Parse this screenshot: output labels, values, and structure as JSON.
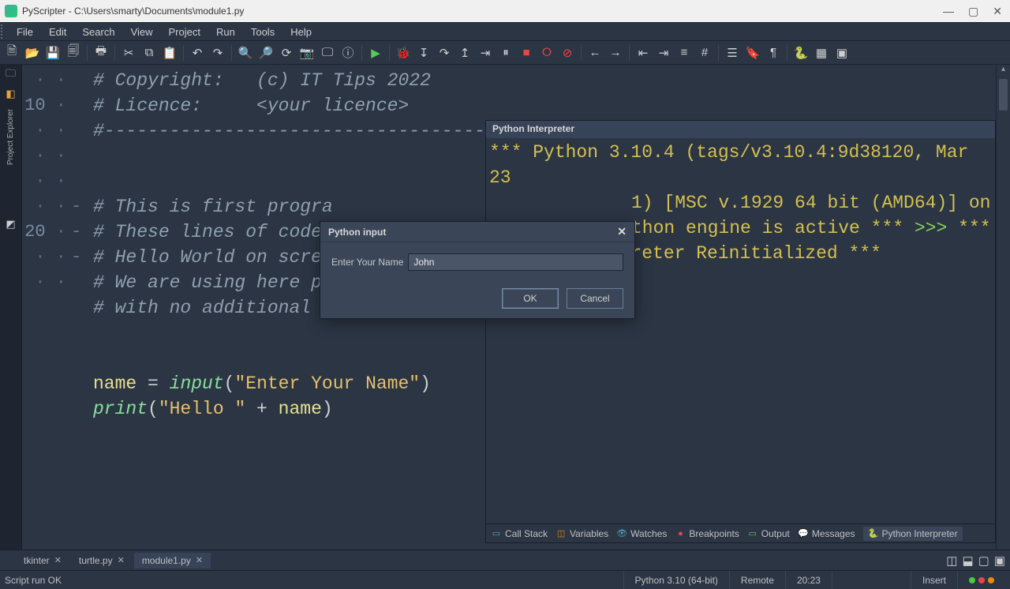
{
  "window": {
    "title": "PyScripter - C:\\Users\\smarty\\Documents\\module1.py"
  },
  "menu": [
    "File",
    "Edit",
    "Search",
    "View",
    "Project",
    "Run",
    "Tools",
    "Help"
  ],
  "sidebar": {
    "label": "Project Explorer"
  },
  "gutter": {
    "line10": "10",
    "line20": "20"
  },
  "code": {
    "l1": "# Copyright:   (c) IT Tips 2022",
    "l2": "# Licence:     <your licence>",
    "l3": "#-------------------------------------------------------------------",
    "l4": "# This is first progra",
    "l5": "# These lines of code",
    "l6": "# Hello World on screen.",
    "l7": "# We are using here print statement",
    "l8": "# with no additional arguments",
    "name_var": "name",
    "eq": " = ",
    "input_fn": "input",
    "input_arg": "\"Enter Your Name\"",
    "print_fn": "print",
    "hello_str": "\"Hello \"",
    "plus": " + ",
    "name_ref": "name"
  },
  "interpreter": {
    "title": "Python Interpreter",
    "l1": "*** Python 3.10.4 (tags/v3.10.4:9d38120, Mar 23",
    "l2": "1) [MSC v.1929 64 bit (AMD64)] on",
    "l3": "thon engine is active ***",
    "prompt": ">>>",
    "l4": "*** Remote Interpreter Reinitialized ***"
  },
  "interp_tabs": {
    "callstack": "Call Stack",
    "variables": "Variables",
    "watches": "Watches",
    "breakpoints": "Breakpoints",
    "output": "Output",
    "messages": "Messages",
    "interpreter": "Python Interpreter"
  },
  "bottom_tabs": {
    "t1": "tkinter",
    "t2": "turtle.py",
    "t3": "module1.py"
  },
  "status": {
    "run": "Script run OK",
    "python": "Python 3.10 (64-bit)",
    "remote": "Remote",
    "pos": "20:23",
    "insert": "Insert"
  },
  "dialog": {
    "title": "Python input",
    "label": "Enter Your Name",
    "value": "John",
    "ok": "OK",
    "cancel": "Cancel"
  }
}
